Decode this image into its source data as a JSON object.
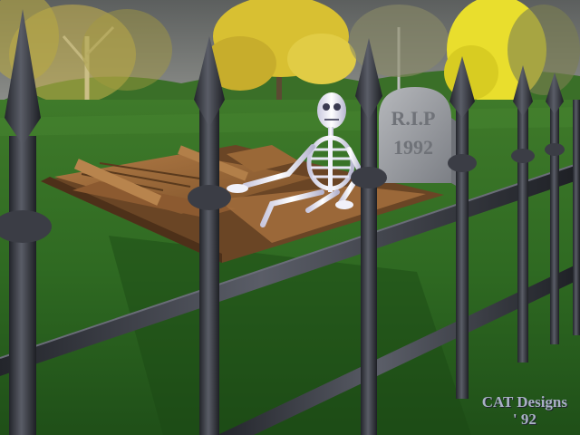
{
  "scene": {
    "sky_color": "#6a6d6c",
    "grass_color": "#2f6a22",
    "fence_color": "#3b3d45",
    "foliage_color": "#d9c23a"
  },
  "tombstone": {
    "line1": "R.I.P",
    "line2": "1992"
  },
  "credit": {
    "line1": "CAT  Designs",
    "line2": "' 92"
  }
}
